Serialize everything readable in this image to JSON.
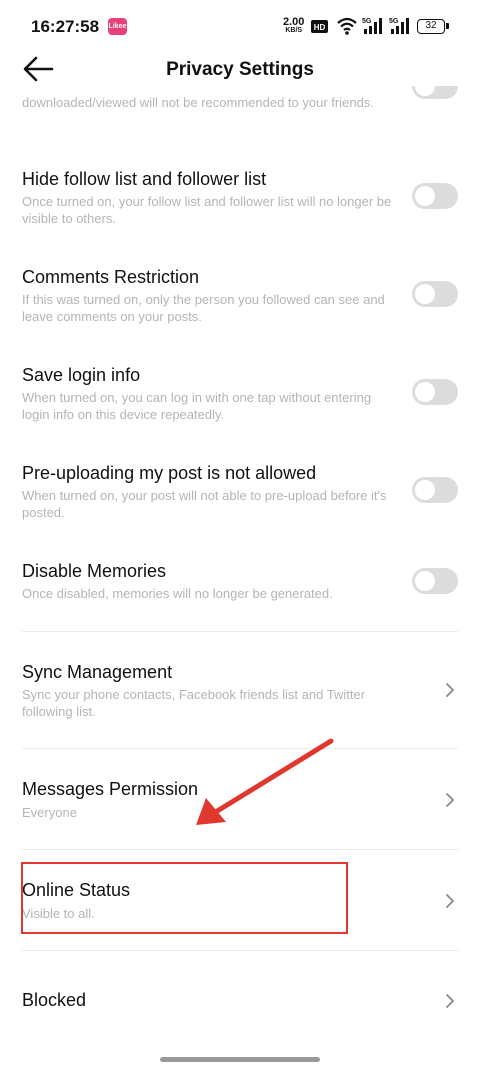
{
  "status_bar": {
    "time": "16:27:58",
    "app_badge": "Likee",
    "net_speed": "2.00",
    "net_unit": "KB/S",
    "hd": "HD",
    "battery": "32"
  },
  "header": {
    "title": "Privacy Settings"
  },
  "settings": {
    "partial_desc": "downloaded/viewed will not be recommended to your friends.",
    "hide_follow": {
      "title": "Hide follow list and follower list",
      "desc": "Once turned on, your follow list and follower list will no longer be visible to others.",
      "enabled": false
    },
    "comments": {
      "title": "Comments Restriction",
      "desc": "If this was turned on, only the person you followed can see and leave comments on your posts.",
      "enabled": false
    },
    "save_login": {
      "title": "Save login info",
      "desc": "When turned on, you can log in with one tap without entering login info on this device repeatedly.",
      "enabled": false
    },
    "preupload": {
      "title": "Pre-uploading my post is not allowed",
      "desc": "When turned on, your post will not able to pre-upload before it's posted.",
      "enabled": false
    },
    "memories": {
      "title": "Disable Memories",
      "desc": "Once disabled, memories will no longer be generated.",
      "enabled": false
    },
    "sync": {
      "title": "Sync Management",
      "desc": "Sync your phone contacts, Facebook friends list and Twitter following list."
    },
    "messages": {
      "title": "Messages Permission",
      "value": "Everyone"
    },
    "online": {
      "title": "Online Status",
      "value": "Visible to all."
    },
    "blocked": {
      "title": "Blocked"
    }
  },
  "annotation_colors": {
    "arrow": "#e0382e",
    "highlight_box": "#e0382e"
  }
}
